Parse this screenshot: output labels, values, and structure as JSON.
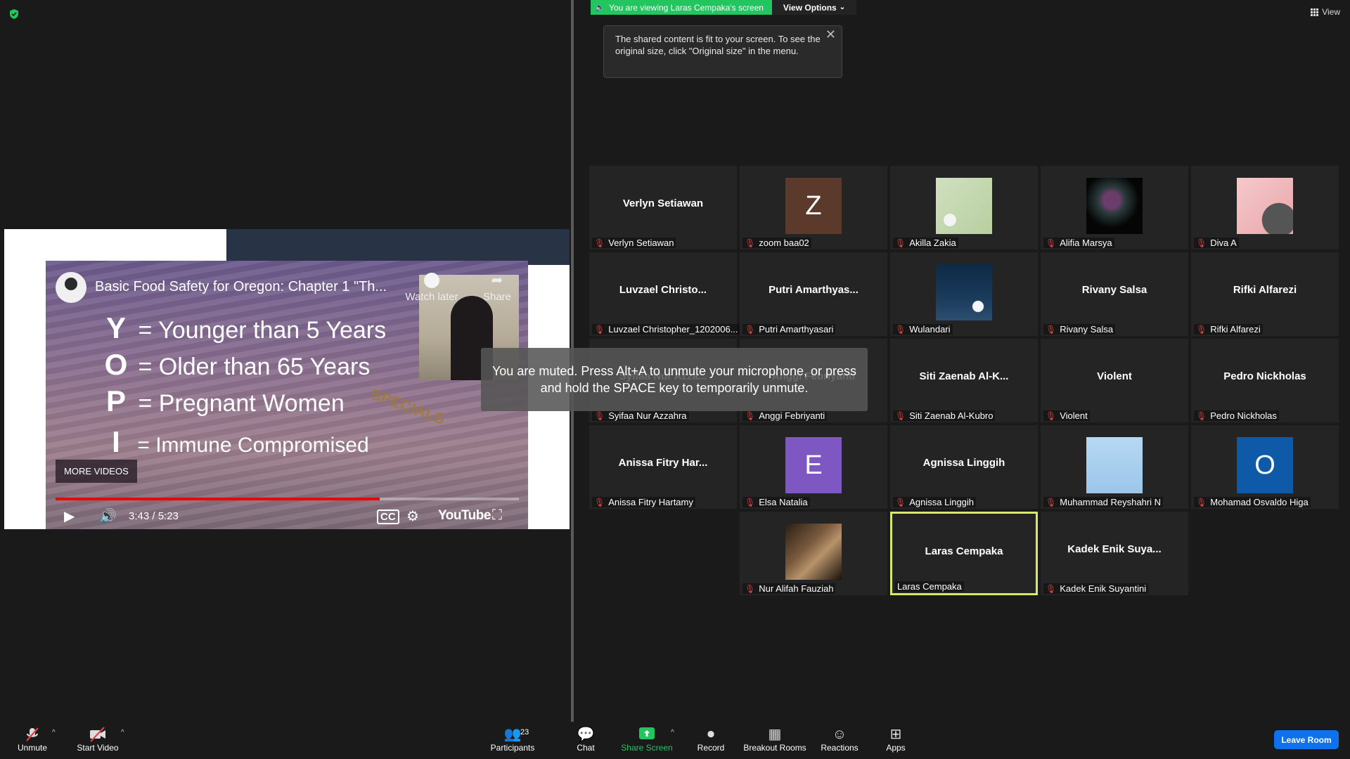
{
  "banner": {
    "viewing_text": "You are viewing Laras Cempaka's screen",
    "view_options": "View Options",
    "view_options_caret": "⌄",
    "view_label": "View"
  },
  "tooltip": {
    "text": "The shared content is fit to your screen. To see the original size, click \"Original size\" in the menu.",
    "close": "✕"
  },
  "video": {
    "title": "Basic Food Safety for Oregon: Chapter 1 \"Th...",
    "watch_later": "Watch later",
    "share": "Share",
    "lines": [
      {
        "letter": "Y",
        "eq": "=",
        "text": "Younger than 5 Years"
      },
      {
        "letter": "O",
        "eq": "=",
        "text": "Older than 65 Years"
      },
      {
        "letter": "P",
        "eq": "=",
        "text": "Pregnant Women"
      },
      {
        "letter": "I",
        "eq": "=",
        "text": "Immune Compromised"
      }
    ],
    "specials": "SPECIALS",
    "more_videos": "MORE VIDEOS",
    "time": "3:43 / 5:23",
    "brand": "YouTube",
    "progress": 0.7
  },
  "muted_toast": "You are muted. Press Alt+A to unmute your microphone, or press and hold the SPACE key to temporarily unmute.",
  "participants": [
    {
      "name": "Verlyn Setiawan",
      "label": "Verlyn Setiawan",
      "muted": true
    },
    {
      "name": "",
      "label": "zoom baa02",
      "avatar": "Z",
      "avatar_color": "#5b3a2c",
      "muted": true
    },
    {
      "name": "",
      "label": "Akilla Zakia",
      "image": "flower",
      "muted": true
    },
    {
      "name": "",
      "label": "Alifia Marsya",
      "image": "dark-cloud",
      "muted": true
    },
    {
      "name": "",
      "label": "Diva A",
      "image": "pink-abstract",
      "muted": true
    },
    {
      "name": "Luvzael Christo...",
      "label": "Luvzael Christopher_1202006...",
      "muted": true
    },
    {
      "name": "Putri Amarthyas...",
      "label": "Putri Amarthyasari",
      "muted": true
    },
    {
      "name": "",
      "label": "Wulandari",
      "image": "night-moon",
      "muted": true
    },
    {
      "name": "Rivany Salsa",
      "label": "Rivany Salsa",
      "muted": true
    },
    {
      "name": "Rifki Alfarezi",
      "label": "Rifki Alfarezi",
      "muted": true
    },
    {
      "name": "Syifaa Nur Azza...",
      "label": "Syifaa Nur Azzahra",
      "muted": true
    },
    {
      "name": "Anggi Febriyanti",
      "label": "Anggi Febriyanti",
      "muted": true
    },
    {
      "name": "Siti Zaenab Al-K...",
      "label": "Siti Zaenab Al-Kubro",
      "muted": true
    },
    {
      "name": "Violent",
      "label": "Violent",
      "muted": true
    },
    {
      "name": "Pedro Nickholas",
      "label": "Pedro Nickholas",
      "muted": true
    },
    {
      "name": "Anissa Fitry Har...",
      "label": "Anissa Fitry Hartamy",
      "muted": true
    },
    {
      "name": "",
      "label": "Elsa Natalia",
      "avatar": "E",
      "avatar_color": "#7e57c2",
      "muted": true
    },
    {
      "name": "Agnissa Linggih",
      "label": "Agnissa Linggih",
      "muted": true
    },
    {
      "name": "",
      "label": "Muhammad Reyshahri N",
      "image": "light-blue",
      "muted": true
    },
    {
      "name": "",
      "label": "Mohamad Osvaldo Higa",
      "avatar": "O",
      "avatar_color": "#0f5aa8",
      "muted": true
    },
    {
      "name": "",
      "label": "Nur Alifah Fauziah",
      "image": "room-photo",
      "muted": true
    },
    {
      "name": "Laras Cempaka",
      "label": "Laras Cempaka",
      "muted": false,
      "active": true
    },
    {
      "name": "Kadek Enik Suya...",
      "label": "Kadek Enik Suyantini",
      "muted": true
    }
  ],
  "toolbar": {
    "unmute": "Unmute",
    "start_video": "Start Video",
    "participants": "Participants",
    "participants_count": "23",
    "chat": "Chat",
    "share_screen": "Share Screen",
    "record": "Record",
    "breakout_rooms": "Breakout Rooms",
    "reactions": "Reactions",
    "apps": "Apps",
    "leave_room": "Leave Room"
  },
  "colors": {
    "accent_green": "#22c55e",
    "leave_blue": "#0e72ed",
    "active_border": "#d9e86a",
    "mute_red": "#e04040"
  }
}
